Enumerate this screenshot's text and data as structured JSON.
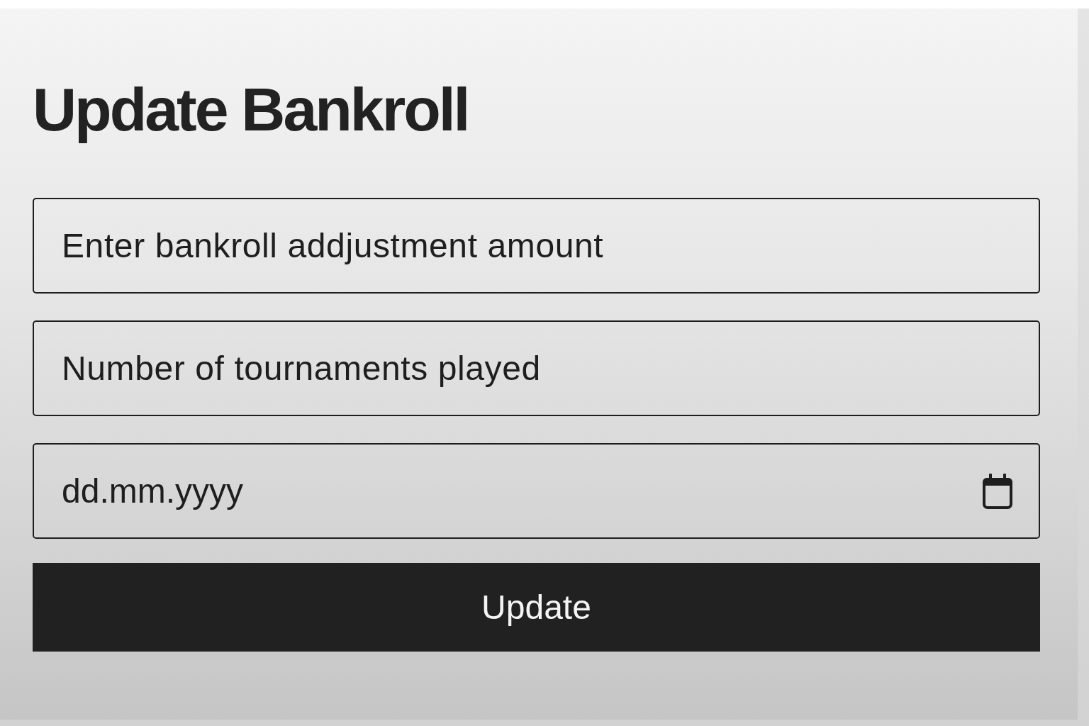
{
  "form": {
    "title": "Update Bankroll",
    "fields": [
      {
        "kind": "text",
        "placeholder": "Enter bankroll addjustment amount"
      },
      {
        "kind": "text",
        "placeholder": "Number of tournaments played"
      },
      {
        "kind": "date",
        "placeholder": "dd.mm.yyyy"
      }
    ],
    "submit_button": {
      "label": "Update"
    }
  }
}
